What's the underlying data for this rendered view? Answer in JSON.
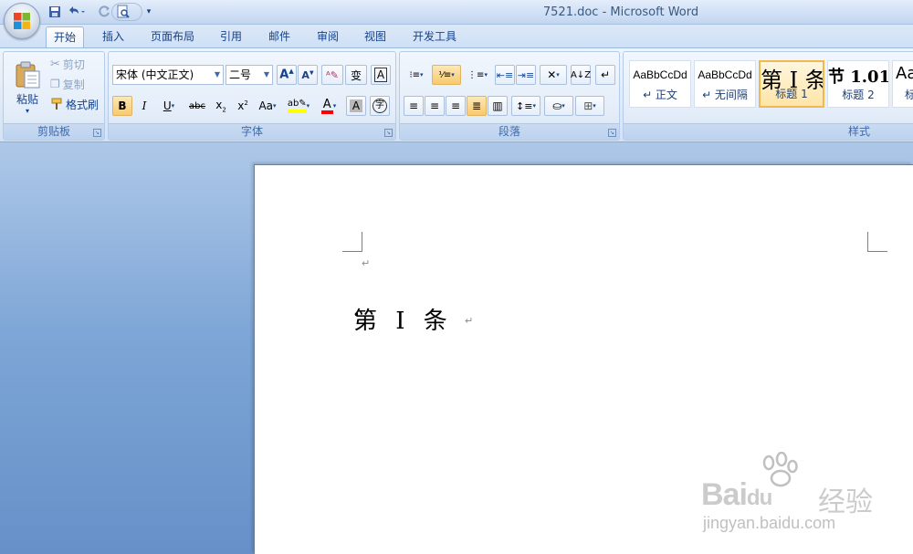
{
  "window": {
    "title": "7521.doc - Microsoft Word"
  },
  "quick_access": {
    "icons": [
      "save-icon",
      "undo-icon",
      "redo-icon",
      "print-preview-icon",
      "customize-icon"
    ]
  },
  "tabs": [
    {
      "label": "开始",
      "active": true
    },
    {
      "label": "插入"
    },
    {
      "label": "页面布局"
    },
    {
      "label": "引用"
    },
    {
      "label": "邮件"
    },
    {
      "label": "审阅"
    },
    {
      "label": "视图"
    },
    {
      "label": "开发工具"
    }
  ],
  "clipboard": {
    "label": "剪贴板",
    "paste": "粘贴",
    "cut": "剪切",
    "copy": "复制",
    "format_painter": "格式刷"
  },
  "font": {
    "label": "字体",
    "name": "宋体 (中文正文)",
    "size": "二号",
    "highlight_color": "#ffff00",
    "font_color": "#ff0000"
  },
  "paragraph": {
    "label": "段落"
  },
  "styles": {
    "label": "样式",
    "items": [
      {
        "sample": "AaBbCcDd",
        "name": "↵ 正文"
      },
      {
        "sample": "AaBbCcDd",
        "name": "↵ 无间隔"
      },
      {
        "sample": "第 I 条",
        "name": "标题 1",
        "selected": true
      },
      {
        "sample": "节 1.01",
        "name": "标题 2"
      },
      {
        "sample": "Aa",
        "name": "标"
      }
    ]
  },
  "document": {
    "heading_text": "第 I 条",
    "paragraph_mark": "↵"
  },
  "watermark": {
    "brand": "Bai",
    "brand_tail": "du",
    "brand_cn": "经验",
    "url": "jingyan.baidu.com"
  }
}
